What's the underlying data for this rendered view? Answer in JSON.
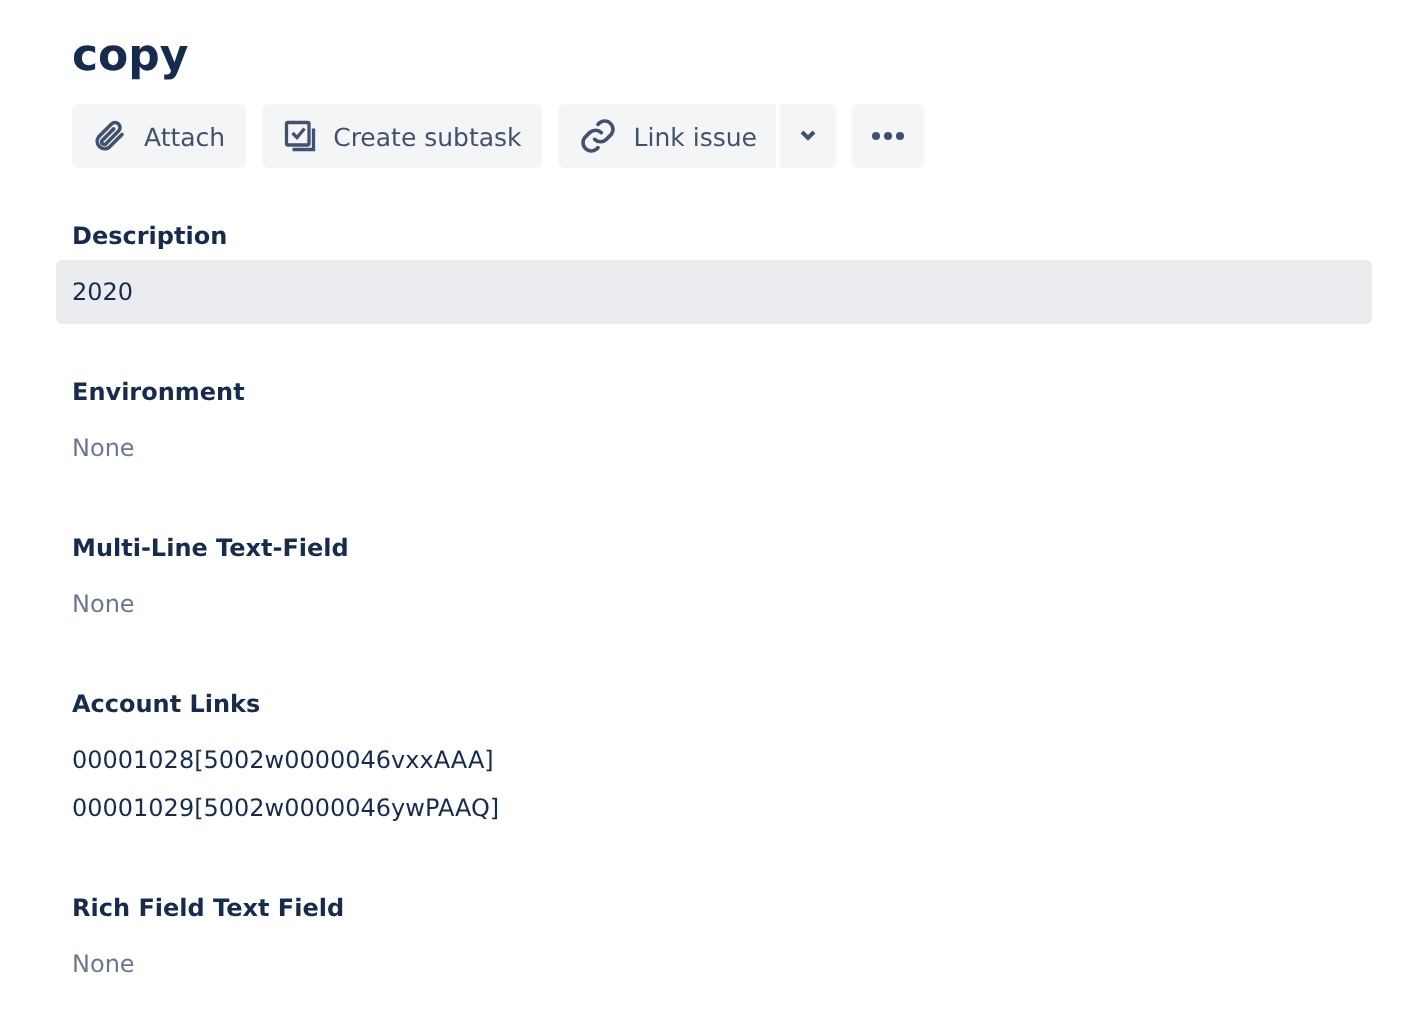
{
  "title": "copy",
  "toolbar": [
    {
      "kind": "button",
      "label": "Attach"
    },
    {
      "kind": "button",
      "label": "Create subtask"
    },
    {
      "kind": "split",
      "label": "Link issue"
    },
    {
      "kind": "more"
    }
  ],
  "fields": [
    {
      "label": "Description",
      "highlighted": true,
      "empty": false,
      "values": [
        "2020"
      ]
    },
    {
      "label": "Environment",
      "highlighted": false,
      "empty": true,
      "values": [
        "None"
      ]
    },
    {
      "label": "Multi-Line Text-Field",
      "highlighted": false,
      "empty": true,
      "values": [
        "None"
      ]
    },
    {
      "label": "Account Links",
      "highlighted": false,
      "empty": false,
      "values": [
        "00001028[5002w0000046vxxAAA]",
        "00001029[5002w0000046ywPAAQ]"
      ]
    },
    {
      "label": "Rich Field Text Field",
      "highlighted": false,
      "empty": true,
      "values": [
        "None"
      ]
    }
  ]
}
